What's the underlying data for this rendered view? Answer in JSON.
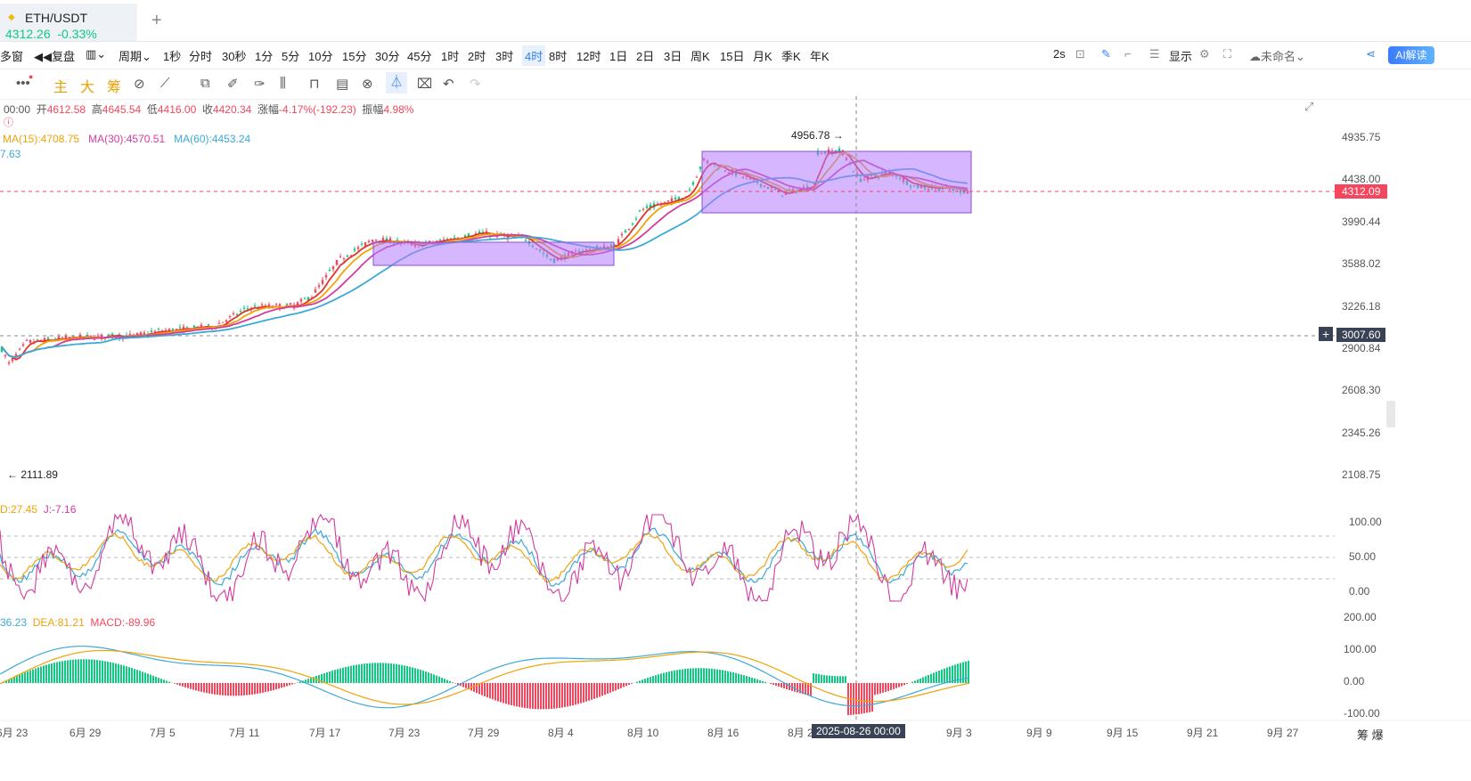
{
  "tab": {
    "symbol": "ETH/USDT",
    "price": "4312.26",
    "change": "-0.33%"
  },
  "toolbar": {
    "multi_window": "多窗",
    "replay": "复盘",
    "period": "周期",
    "intervals": [
      "1秒",
      "分时",
      "30秒",
      "1分",
      "5分",
      "10分",
      "15分",
      "30分",
      "45分",
      "1时",
      "2时",
      "3时",
      "4时",
      "8时",
      "12时",
      "1日",
      "2日",
      "3日",
      "周K",
      "15日",
      "月K",
      "季K",
      "年K"
    ],
    "active_interval": "4时",
    "refresh": "2s",
    "display": "显示",
    "unnamed": "未命名",
    "ai": "AI解读"
  },
  "draw_tools": {
    "main": "主",
    "big": "大",
    "chip": "筹"
  },
  "ohlc": {
    "time": "00:00",
    "open_label": "开",
    "open": "4612.58",
    "high_label": "高",
    "high": "4645.54",
    "low_label": "低",
    "low": "4416.00",
    "close_label": "收",
    "close": "4420.34",
    "change_label": "涨幅",
    "change": "-4.17%(-192.23)",
    "amp_label": "振幅",
    "amp": "4.98%"
  },
  "ma": {
    "ma15": "MA(15):4708.75",
    "ma30": "MA(30):4570.51",
    "ma60": "MA(60):4453.24",
    "extra": "7.63"
  },
  "kdj": {
    "d": "D:27.45",
    "j": "J:-7.16"
  },
  "macd": {
    "dif": "36.23",
    "dea": "DEA:81.21",
    "macd": "MACD:-89.96"
  },
  "price_axis": [
    "4935.75",
    "4438.00",
    "3990.44",
    "3588.02",
    "3226.18",
    "2900.84",
    "2608.30",
    "2345.26",
    "2108.75"
  ],
  "current_price_tag": "4312.09",
  "crosshair_price": "3007.60",
  "kdj_axis": [
    "100.00",
    "50.00",
    "0.00"
  ],
  "macd_axis": [
    "200.00",
    "100.00",
    "0.00",
    "-100.00"
  ],
  "date_axis": [
    "6月 23",
    "6月 29",
    "7月 5",
    "7月 11",
    "7月 17",
    "7月 23",
    "7月 29",
    "8月 4",
    "8月 10",
    "8月 16",
    "8月 22",
    "9月 3",
    "9月 9",
    "9月 15",
    "9月 21",
    "9月 27"
  ],
  "crosshair_date": "2025-08-26 00:00",
  "annotations": {
    "high": "4956.78",
    "low": "2111.89"
  },
  "corner": "筹 爆",
  "colors": {
    "up": "#0ecb81",
    "down": "#f6465d",
    "ma15": "#e0342c",
    "ma30": "#f0a30a",
    "ma60": "#d23ca0",
    "ma_long": "#3ca9d8",
    "box": "#b57cff",
    "accent": "#2f80ed"
  }
}
